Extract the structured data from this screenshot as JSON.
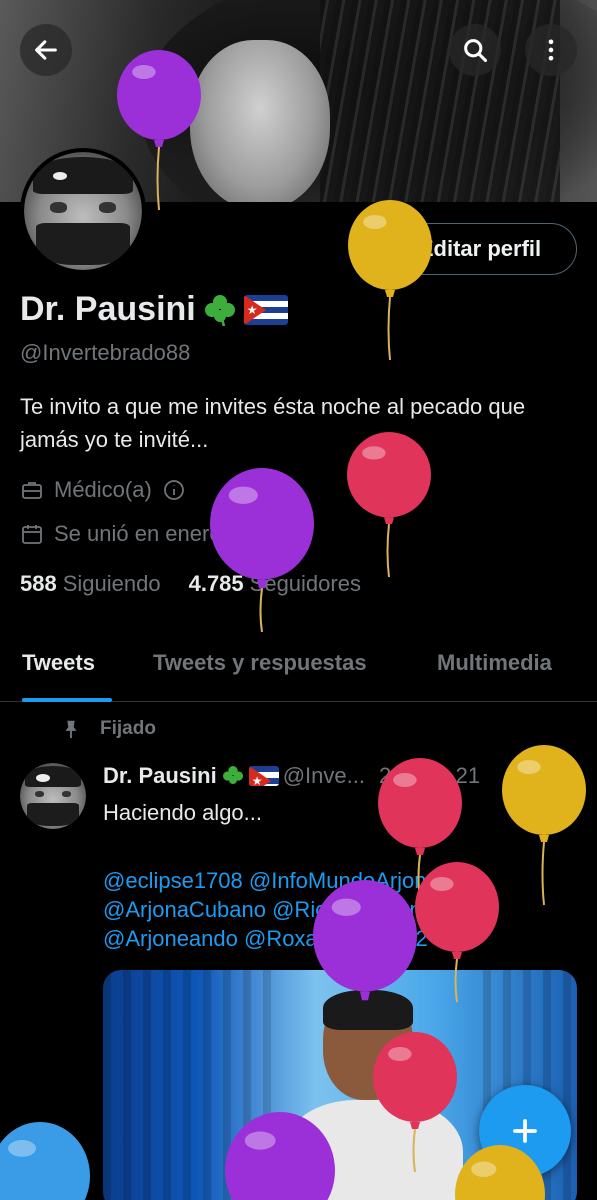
{
  "header": {
    "back_icon": "arrow-left-icon",
    "search_icon": "search-icon",
    "more_icon": "more-vertical-icon"
  },
  "profile": {
    "display_name": "Dr. Pausini",
    "handle": "@Invertebrado88",
    "edit_button": "Editar perfil",
    "bio": "Te invito a que me invites ésta noche al pecado que jamás yo te invité...",
    "profession": "Médico(a)",
    "joined": "Se unió en enero de 2017",
    "following_count": "588",
    "following_label": "Siguiendo",
    "followers_count": "4.785",
    "followers_label": "Seguidores"
  },
  "tabs": [
    {
      "label": "Tweets",
      "active": true
    },
    {
      "label": "Tweets y respuestas",
      "active": false
    },
    {
      "label": "Multimedia",
      "active": false
    }
  ],
  "pinned_tweet": {
    "pinned_label": "Fijado",
    "author_name": "Dr. Pausini",
    "author_handle": "@Inve...",
    "date": "24 nov. 21",
    "text": "Haciendo algo...",
    "mentions_line1": "@eclipse1708 @InfoMundoArjona",
    "mentions_line2": "@ArjonaCubano @RicardoArjona",
    "mentions_line3": "@Arjoneando @RoxanaLenLen2"
  },
  "colors": {
    "accent": "#1d9bf0",
    "text_primary": "#e7e9ea",
    "text_secondary": "#71767b",
    "balloon_purple": "#9b30d9",
    "balloon_gold": "#e0b21c",
    "balloon_red": "#e0345a",
    "balloon_blue": "#3a9be6"
  },
  "fab_icon": "plus-icon"
}
